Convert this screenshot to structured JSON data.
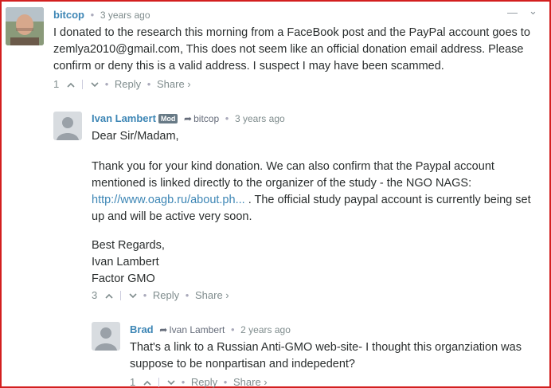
{
  "comments": [
    {
      "author": "bitcop",
      "time": "3 years ago",
      "text": "I donated to the research this morning from a FaceBook post and the PayPal account goes to zemlya2010@gmail.com, This does not seem like an official donation email address. Please confirm or deny this is a valid address. I suspect I may have been scammed.",
      "votes": "1",
      "reply_label": "Reply",
      "share_label": "Share ›",
      "collapse": "—",
      "menu": "⌄"
    },
    {
      "author": "Ivan Lambert",
      "badge": "Mod",
      "parent": "bitcop",
      "time": "3 years ago",
      "greeting": "Dear Sir/Madam,",
      "p1_before": "Thank you for your kind donation. We can also confirm that the Paypal account mentioned is linked directly to the organizer of the study - the NGO NAGS:",
      "link": "http://www.oagb.ru/about.ph...",
      "p1_after": ". The official study paypal account is currently being set up and will be active very soon.",
      "sign1": "Best Regards,",
      "sign2": "Ivan Lambert",
      "sign3": "Factor GMO",
      "votes": "3",
      "reply_label": "Reply",
      "share_label": "Share ›"
    },
    {
      "author": "Brad",
      "parent": "Ivan Lambert",
      "time": "2 years ago",
      "text": "That's a link to a Russian Anti-GMO web-site- I thought this organziation was suppose to be nonpartisan and indepedent?",
      "votes": "1",
      "reply_label": "Reply",
      "share_label": "Share ›"
    }
  ],
  "colors": {
    "frame": "#d31f1f",
    "author": "#3d86b5",
    "text": "#2a2e2e",
    "meta": "#7f8c8d"
  }
}
